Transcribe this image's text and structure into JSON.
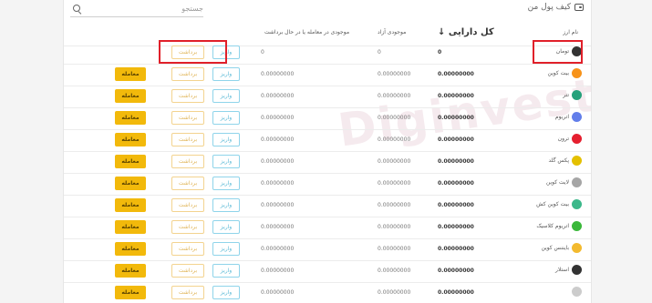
{
  "header": {
    "title": "کیف پول من",
    "search_placeholder": "جستجو"
  },
  "columns": {
    "name": "نام ارز",
    "total": "کل دارایی ↓",
    "free": "موجودی آزاد",
    "trading": "موجودی در معامله یا در حال برداشت"
  },
  "buttons": {
    "deposit": "واریز",
    "withdraw": "برداشت",
    "trade": "معامله"
  },
  "watermark": "Diginvest",
  "colors": {
    "trade": "#f2b90b",
    "deposit_border": "#8fd4ea",
    "withdraw_border": "#f3d38f",
    "highlight": "#e0202a"
  },
  "rows": [
    {
      "name": "تومان",
      "icon": "toman-icon",
      "icon_color": "#333333",
      "total": "0",
      "free": "0",
      "trading": "0",
      "has_trade": false
    },
    {
      "name": "بیت کوین",
      "icon": "bitcoin-icon",
      "icon_color": "#f7931a",
      "total": "0.00000000",
      "free": "0.00000000",
      "trading": "0.00000000",
      "has_trade": true
    },
    {
      "name": "تتر",
      "icon": "tether-icon",
      "icon_color": "#26a17b",
      "total": "0.00000000",
      "free": "0.00000000",
      "trading": "0.00000000",
      "has_trade": true
    },
    {
      "name": "اتریوم",
      "icon": "ethereum-icon",
      "icon_color": "#627eea",
      "total": "0.00000000",
      "free": "0.00000000",
      "trading": "0.00000000",
      "has_trade": true
    },
    {
      "name": "ترون",
      "icon": "tron-icon",
      "icon_color": "#e51f2f",
      "total": "0.00000000",
      "free": "0.00000000",
      "trading": "0.00000000",
      "has_trade": true
    },
    {
      "name": "پکس گلد",
      "icon": "paxgold-icon",
      "icon_color": "#e4c000",
      "total": "0.00000000",
      "free": "0.00000000",
      "trading": "0.00000000",
      "has_trade": true
    },
    {
      "name": "لایت کوین",
      "icon": "litecoin-icon",
      "icon_color": "#a6a6a6",
      "total": "0.00000000",
      "free": "0.00000000",
      "trading": "0.00000000",
      "has_trade": true
    },
    {
      "name": "بیت کوین کش",
      "icon": "bitcoincash-icon",
      "icon_color": "#3cb88a",
      "total": "0.00000000",
      "free": "0.00000000",
      "trading": "0.00000000",
      "has_trade": true
    },
    {
      "name": "اتریوم کلاسیک",
      "icon": "ethereum-classic-icon",
      "icon_color": "#3ab83a",
      "total": "0.00000000",
      "free": "0.00000000",
      "trading": "0.00000000",
      "has_trade": true
    },
    {
      "name": "بایننس کوین",
      "icon": "binance-coin-icon",
      "icon_color": "#f3ba2f",
      "total": "0.00000000",
      "free": "0.00000000",
      "trading": "0.00000000",
      "has_trade": true
    },
    {
      "name": "استلار",
      "icon": "stellar-icon",
      "icon_color": "#333333",
      "total": "0.00000000",
      "free": "0.00000000",
      "trading": "0.00000000",
      "has_trade": true
    },
    {
      "name": "",
      "icon": "coin-icon",
      "icon_color": "#cccccc",
      "total": "0.00000000",
      "free": "0.00000000",
      "trading": "0.00000000",
      "has_trade": true
    }
  ]
}
